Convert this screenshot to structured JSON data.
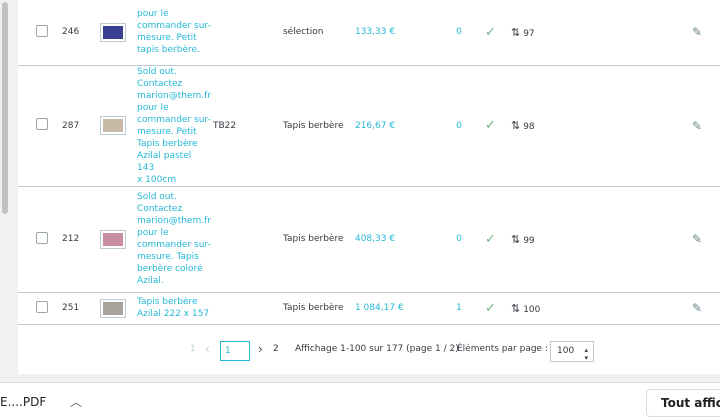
{
  "rows": [
    {
      "id": "246",
      "name": [
        "pour le",
        "commander sur-",
        "mesure. Petit",
        "tapis berbère."
      ],
      "reference": "",
      "category": "sélection",
      "price": "133,33 €",
      "quantity": "0",
      "position": "97",
      "thumb_color": "#3a3f8f"
    },
    {
      "id": "287",
      "name": [
        "Sold out.",
        "Contactez",
        "marion@them.fr",
        "pour le",
        "commander sur-",
        "mesure. Petit",
        "Tapis berbère",
        "Azilal pastel 143",
        "x 100cm"
      ],
      "reference": "TB22",
      "category": "Tapis berbère",
      "price": "216,67 €",
      "quantity": "0",
      "position": "98",
      "thumb_color": "#c9b9a7"
    },
    {
      "id": "212",
      "name": [
        "Sold out.",
        "Contactez",
        "marion@them.fr",
        "pour le",
        "commander sur-",
        "mesure. Tapis",
        "berbère coloré",
        "Azilal."
      ],
      "reference": "",
      "category": "Tapis berbère",
      "price": "408,33 €",
      "quantity": "0",
      "position": "99",
      "thumb_color": "#c98fa0"
    },
    {
      "id": "251",
      "name": [
        "Tapis berbère",
        "Azilal 222 x 157"
      ],
      "reference": "",
      "category": "Tapis berbère",
      "price": "1 084,17 €",
      "quantity": "1",
      "position": "100",
      "thumb_color": "#a7a49c"
    }
  ],
  "pagination": {
    "first": "1",
    "current": "1",
    "next_page": "2",
    "summary": "Affichage 1-100 sur 177 (page 1 / 2)",
    "per_page_label": "Éléments par page :",
    "per_page_value": "100"
  },
  "download_bar": {
    "file_name": "E....PDF",
    "show_all": "Tout affich"
  },
  "icons": {
    "status": "check-icon",
    "position": "drag-position-icon",
    "edit": "pencil-icon",
    "prev": "chevron-left-icon",
    "next": "chevron-right-icon"
  },
  "colors": {
    "link": "#25b9d7",
    "check": "#70b580",
    "border": "#bbcdd2"
  }
}
